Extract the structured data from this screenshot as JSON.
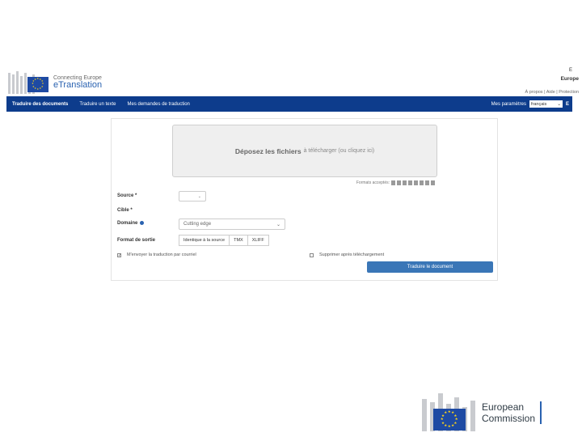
{
  "header": {
    "brand_subtitle": "Connecting Europe",
    "brand_title": "eTranslation",
    "top_right_line1": "E",
    "top_right_line2": "Europe",
    "links": "À propos | Aide | Protection"
  },
  "nav": {
    "items": [
      {
        "label": "Traduire des documents",
        "active": true
      },
      {
        "label": "Traduire un texte",
        "active": false
      },
      {
        "label": "Mes demandes de traduction",
        "active": false
      }
    ],
    "settings_label": "Mes paramètres",
    "language_value": "français",
    "extra": "E"
  },
  "form": {
    "dropzone_strong": "Déposez les fichiers",
    "dropzone_rest": "à télécharger (ou cliquez ici)",
    "formats_label": "Formats acceptés:",
    "source_label": "Source *",
    "target_label": "Cible *",
    "domain_label": "Domaine",
    "domain_value": "Cutting edge",
    "output_label": "Format de sortie",
    "output_options": [
      "Identique à la source",
      "TMX",
      "XLIFF"
    ],
    "email_option": "M'envoyer la traduction par courriel",
    "delete_option": "Supprimer après téléchargement",
    "submit_label": "Traduire le document"
  },
  "footer": {
    "line1": "European",
    "line2": "Commission"
  },
  "colors": {
    "nav_bg": "#0d3c8c",
    "brand_blue": "#2a62b0",
    "flag_blue": "#1e4aa3",
    "flag_star": "#ffd617",
    "submit_bg": "#3a76b7"
  }
}
